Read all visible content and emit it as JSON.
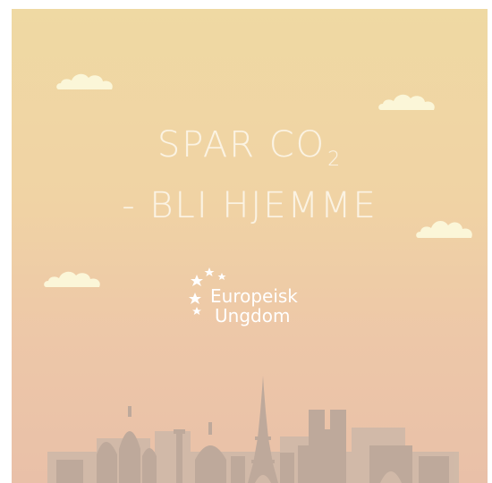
{
  "headline": {
    "line1_main": "SPAR CO",
    "line1_subscript": "2",
    "line2": "- BLI HJEMME"
  },
  "logo": {
    "word1": "Europeisk",
    "word2": "Ungdom",
    "icon": "stars-icon"
  },
  "colors": {
    "background_top": "#efd9a3",
    "background_bottom": "#e9c0a8",
    "headline_text": "#fbf3e3",
    "cloud": "#fbf6d8",
    "skyline": "#c8b3a4"
  },
  "illustration": {
    "clouds": [
      "cloud-icon",
      "cloud-icon",
      "cloud-icon",
      "cloud-icon"
    ],
    "skyline": "paris-skyline-illustration"
  }
}
